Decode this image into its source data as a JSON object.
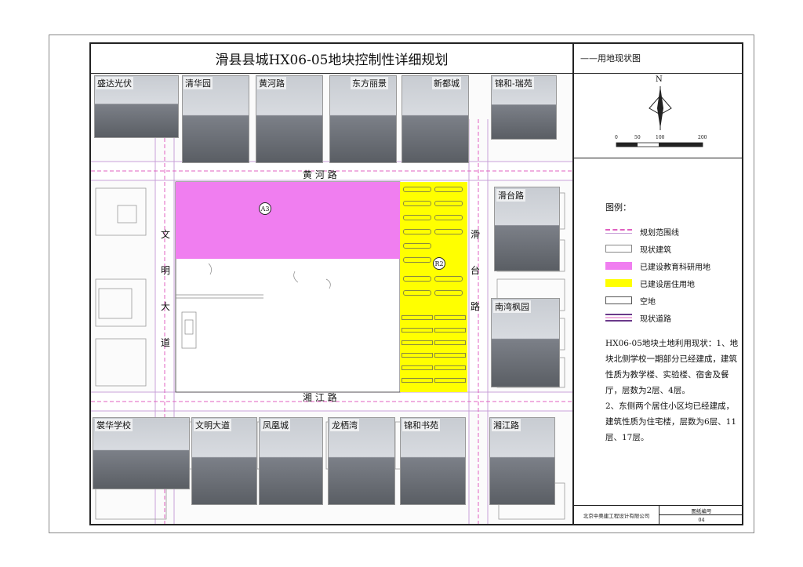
{
  "title": "滑县县城HX06-05地块控制性详细规划",
  "subtitle": "——用地现状图",
  "compass": {
    "north": "N",
    "scale_ticks": [
      "0",
      "50",
      "100",
      "200"
    ]
  },
  "roads": {
    "north": "黄  河  路",
    "south": "湘  江  路",
    "west": [
      "文",
      "明",
      "大",
      "道"
    ],
    "east": [
      "滑",
      "台",
      "路"
    ]
  },
  "parcels": {
    "a3": "A3",
    "r2": "R2"
  },
  "photos_top": [
    "盛达光伏",
    "清华园",
    "黄河路",
    "东方丽景",
    "新都城",
    "锦和-瑞苑"
  ],
  "photos_right": [
    "滑台路",
    "南湾枫园"
  ],
  "photos_bottom": [
    "裳华学校",
    "文明大道",
    "凤凰城",
    "龙栖湾",
    "锦和书苑",
    "湘江路"
  ],
  "legend": {
    "title": "图例：",
    "items": [
      {
        "label": "规划范围线",
        "icon": "dashed-pink-line"
      },
      {
        "label": "现状建筑",
        "icon": "building-outline"
      },
      {
        "label": "已建设教育科研用地",
        "color": "#f07ef0"
      },
      {
        "label": "已建设居住用地",
        "color": "#ffff00"
      },
      {
        "label": "空地",
        "color": "#ffffff"
      },
      {
        "label": "现状道路",
        "icon": "road-line"
      }
    ]
  },
  "description": [
    "HX06-05地块土地利用现状：1、地块北侧学校一期部分已经建成，建筑性质为教学楼、实验楼、宿舍及餐厅，层数为2层、4层。",
    "2、东侧两个居住小区均已经建成，建筑性质为住宅楼，层数为6层、11层、17层。"
  ],
  "footer": {
    "company": "北京中奥建工程设计有限公司",
    "drawing_no_label": "图纸编号",
    "drawing_no": "04"
  },
  "colors": {
    "education": "#f07ef0",
    "residential": "#ffff00",
    "boundary": "#e060c0"
  }
}
